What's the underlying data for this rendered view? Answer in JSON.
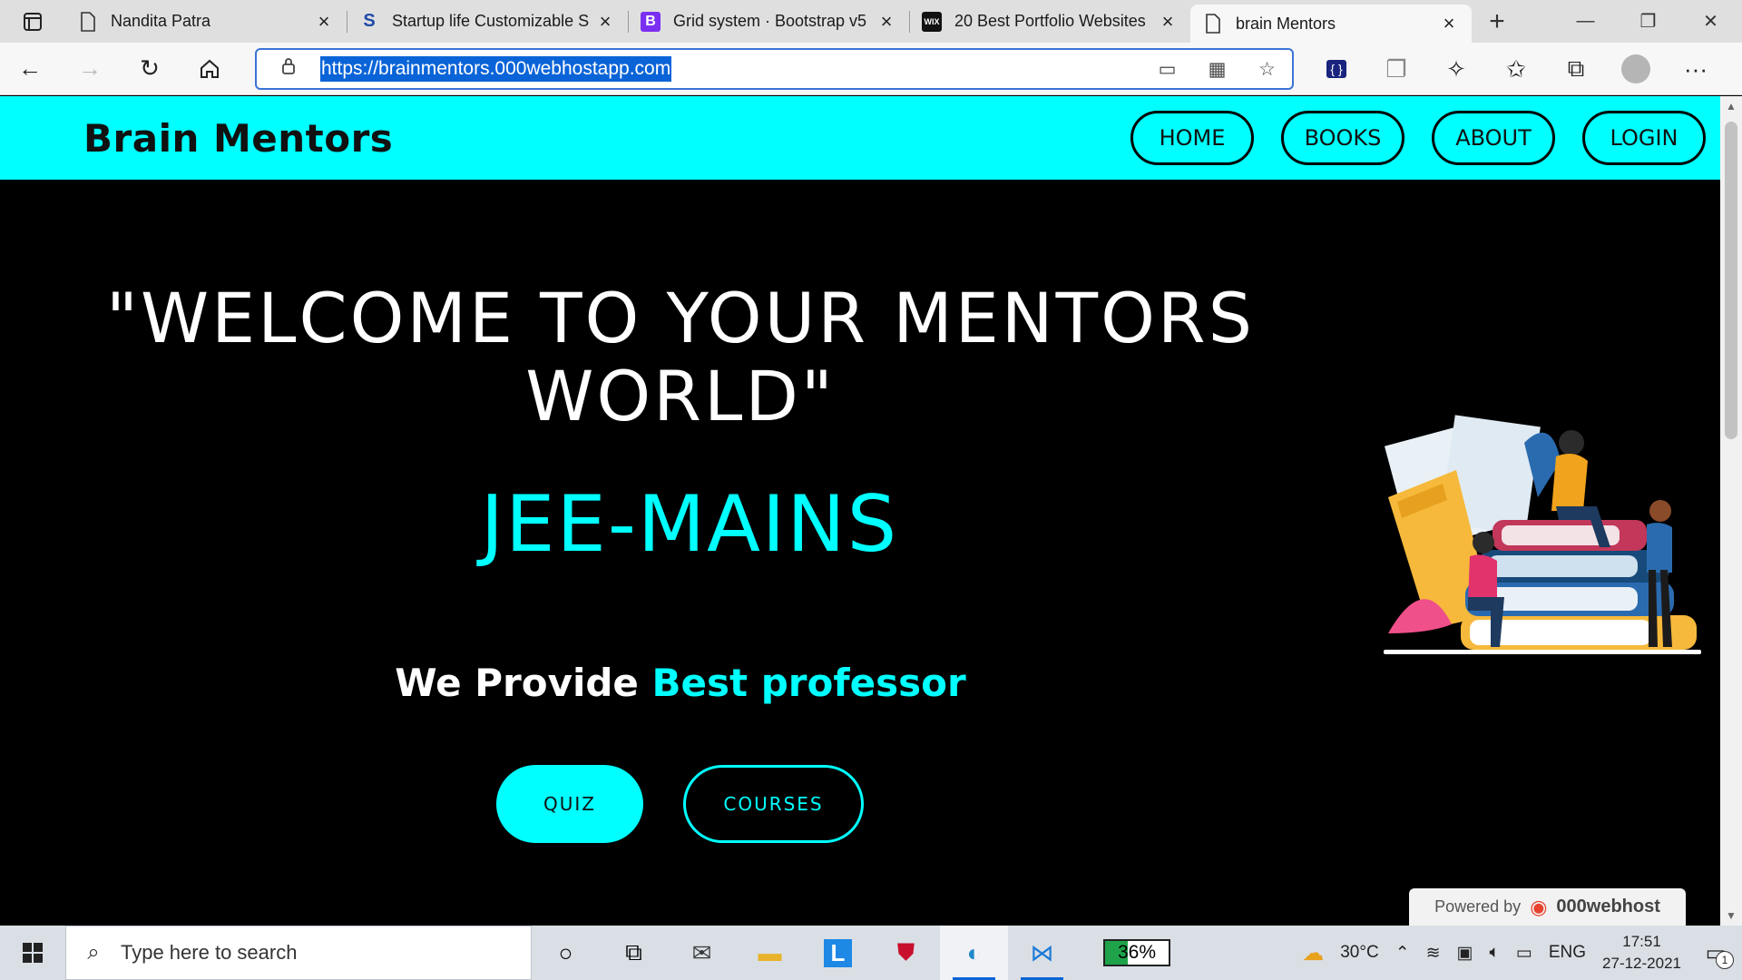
{
  "browser": {
    "tabs": [
      {
        "title": "Nandita Patra",
        "favicon": "page-icon"
      },
      {
        "title": "Startup life Customizable S",
        "favicon": "S"
      },
      {
        "title": "Grid system · Bootstrap v5",
        "favicon": "B"
      },
      {
        "title": "20 Best Portfolio Websites",
        "favicon": "WIX"
      },
      {
        "title": "brain Mentors",
        "favicon": "page-icon",
        "active": true
      }
    ],
    "url": "https://brainmentors.000webhostapp.com"
  },
  "site": {
    "brand": "Brain Mentors",
    "nav": [
      "HOME",
      "BOOKS",
      "ABOUT",
      "LOGIN"
    ],
    "headline_line1": "\"WELCOME TO YOUR MENTORS",
    "headline_line2": "WORLD\"",
    "course": "JEE-MAINS",
    "tagline_plain": "We Provide",
    "tagline_highlight": "Best professor",
    "buttons": {
      "quiz": "QUIZ",
      "courses": "COURSES"
    },
    "powered_by": "Powered by",
    "host_brand": "000webhost",
    "accent_color": "#00ffff"
  },
  "taskbar": {
    "search_placeholder": "Type here to search",
    "battery": "36%",
    "battery_level": 0.36,
    "weather": "30°C",
    "language": "ENG",
    "time": "17:51",
    "date": "27-12-2021",
    "notifications": "1"
  }
}
